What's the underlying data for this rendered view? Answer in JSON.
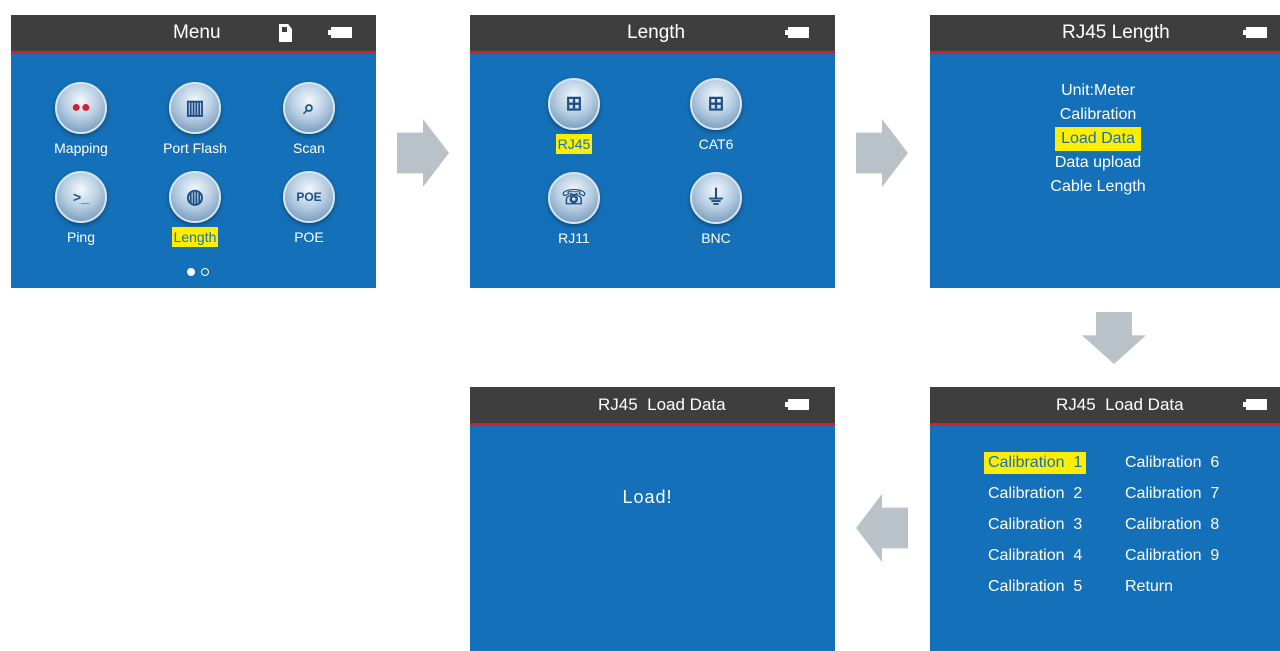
{
  "screens": {
    "menu": {
      "title": "Menu",
      "icons": [
        "sd-card-icon",
        "battery-icon"
      ],
      "apps": [
        {
          "label": "Mapping",
          "icon": "mapping-icon",
          "glyph": "●●"
        },
        {
          "label": "Port Flash",
          "icon": "port-flash-icon",
          "glyph": "▥"
        },
        {
          "label": "Scan",
          "icon": "scan-magnifier-icon",
          "glyph": "⌕"
        },
        {
          "label": "Ping",
          "icon": "ping-terminal-icon",
          "glyph": ">_"
        },
        {
          "label": "Length",
          "icon": "length-globe-icon",
          "glyph": "◍"
        },
        {
          "label": "POE",
          "icon": "poe-icon",
          "glyph": "POE"
        }
      ],
      "selected": "Length"
    },
    "length": {
      "title": "Length",
      "apps": [
        {
          "label": "RJ45",
          "icon": "rj45-icon",
          "glyph": "⊞"
        },
        {
          "label": "CAT6",
          "icon": "cat6-icon",
          "glyph": "⊞"
        },
        {
          "label": "RJ11",
          "icon": "rj11-icon",
          "glyph": "☏"
        },
        {
          "label": "BNC",
          "icon": "bnc-icon",
          "glyph": "⏚"
        }
      ],
      "selected": "RJ45"
    },
    "rj45_length": {
      "title": "RJ45 Length",
      "items": [
        "Unit:Meter",
        "Calibration",
        "Load Data",
        "Data upload",
        "Cable Length"
      ],
      "selected": "Load Data"
    },
    "rj45_load_data_list": {
      "title": "RJ45  Load Data",
      "items": [
        "Calibration  1",
        "Calibration  2",
        "Calibration  3",
        "Calibration  4",
        "Calibration  5",
        "Calibration  6",
        "Calibration  7",
        "Calibration  8",
        "Calibration  9",
        "Return"
      ],
      "selected": "Calibration  1"
    },
    "rj45_load_data_done": {
      "title": "RJ45  Load Data",
      "message": "Load!"
    }
  },
  "arrows": [
    "arrow-right-icon",
    "arrow-right-icon",
    "arrow-down-icon",
    "arrow-left-icon"
  ]
}
